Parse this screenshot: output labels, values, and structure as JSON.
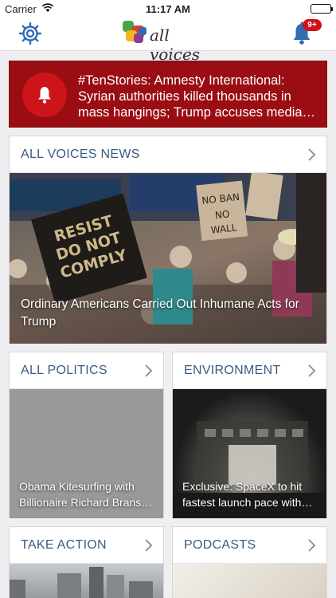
{
  "status_bar": {
    "carrier": "Carrier",
    "time": "11:17 AM"
  },
  "nav": {
    "logo_text": "all voices",
    "notification_count": "9+",
    "icons": {
      "settings": "gear-icon",
      "notifications": "bell-icon"
    }
  },
  "alert": {
    "text": "#TenStories: Amnesty International: Syrian authorities killed thousands in mass hangings; Trump accuses media…",
    "icon": "bell-icon",
    "color": "#9a0d12"
  },
  "sections": {
    "news": {
      "title": "ALL VOICES NEWS",
      "caption": "Ordinary Americans Carried Out Inhumane Acts for Trump",
      "image_signs": [
        "RESIST DO NOT COMPLY",
        "NO BAN NO WALL"
      ]
    },
    "politics": {
      "title": "ALL POLITICS",
      "caption": "Obama Kitesurfing with Billionaire Richard Brans…"
    },
    "environment": {
      "title": "ENVIRONMENT",
      "caption": "Exclusive: SpaceX to hit fastest launch pace with…"
    },
    "action": {
      "title": "TAKE ACTION"
    },
    "podcasts": {
      "title": "PODCASTS"
    }
  },
  "colors": {
    "section_title": "#3c5c82",
    "alert_bg": "#9a0d12",
    "alert_circle": "#cc1419",
    "badge": "#d0111a",
    "nav_icon": "#2e6db4"
  }
}
